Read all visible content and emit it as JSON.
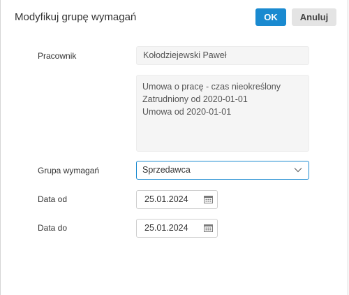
{
  "dialog": {
    "title": "Modyfikuj grupę wymagań",
    "ok_label": "OK",
    "cancel_label": "Anuluj"
  },
  "form": {
    "employee_label": "Pracownik",
    "employee_value": "Kołodziejewski Paweł",
    "contract_info": [
      "Umowa o pracę - czas nieokreślony",
      "Zatrudniony od 2020-01-01",
      "Umowa od 2020-01-01"
    ],
    "group_label": "Grupa wymagań",
    "group_value": "Sprzedawca",
    "date_from_label": "Data od",
    "date_from_value": "25.01.2024",
    "date_to_label": "Data do",
    "date_to_value": "25.01.2024"
  },
  "icons": {
    "dropdown": "chevron-down-icon",
    "calendar": "calendar-icon"
  },
  "colors": {
    "accent": "#1a8ad0",
    "cancel_bg": "#e4e4e4",
    "readonly_bg": "#f5f5f5"
  }
}
